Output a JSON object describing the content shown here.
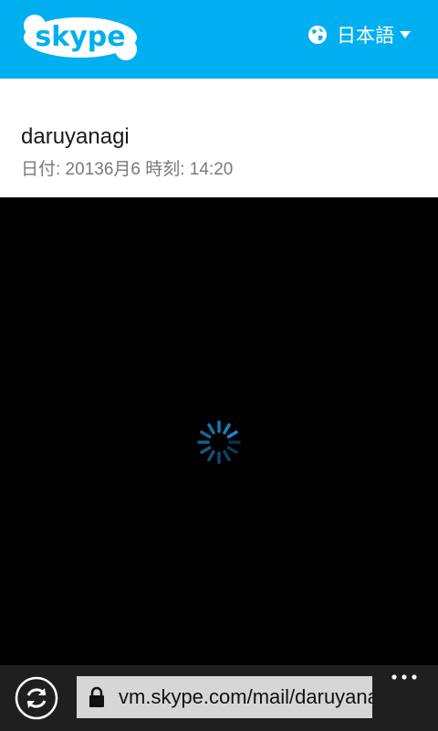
{
  "header": {
    "logo_text": "skype",
    "language_label": "日本語",
    "brand_color": "#00aff0"
  },
  "message": {
    "sender": "daruyanagi",
    "date_line": "日付: 20136月6 時刻: 14:20"
  },
  "player": {
    "state": "loading"
  },
  "browser_bar": {
    "url": "vm.skype.com/mail/daruyanagi",
    "refresh_icon": "refresh-icon",
    "lock_icon": "lock-icon",
    "more_icon": "more-icon"
  }
}
